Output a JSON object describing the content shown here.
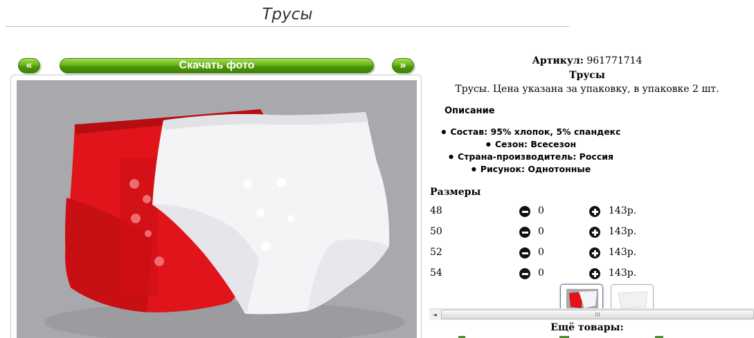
{
  "page": {
    "title": "Трусы"
  },
  "gallery": {
    "prev_label": "«",
    "next_label": "»",
    "download_label": "Скачать фото"
  },
  "product": {
    "article_label": "Артикул:",
    "article_value": "961771714",
    "name": "Трусы",
    "description": "Трусы. Цена указана за упаковку, в упаковке 2 шт."
  },
  "details": {
    "heading": "Описание",
    "features": [
      "Состав: 95% хлопок, 5% спандекс",
      "Сезон: Всесезон",
      "Страна-производитель: Россия",
      "Рисунок: Однотонные"
    ]
  },
  "sizes": {
    "heading": "Размеры",
    "rows": [
      {
        "size": "48",
        "qty": "0",
        "price": "143р."
      },
      {
        "size": "50",
        "qty": "0",
        "price": "143р."
      },
      {
        "size": "52",
        "qty": "0",
        "price": "143р."
      },
      {
        "size": "54",
        "qty": "0",
        "price": "143р."
      }
    ]
  },
  "scrollbar": {
    "left_arrow": "◄",
    "grip": "III"
  },
  "more": {
    "heading": "Ещё товары:"
  },
  "colors": {
    "accent_green": "#5aa814",
    "photo_bg": "#a9a9ad",
    "red_item": "#e0141a"
  }
}
